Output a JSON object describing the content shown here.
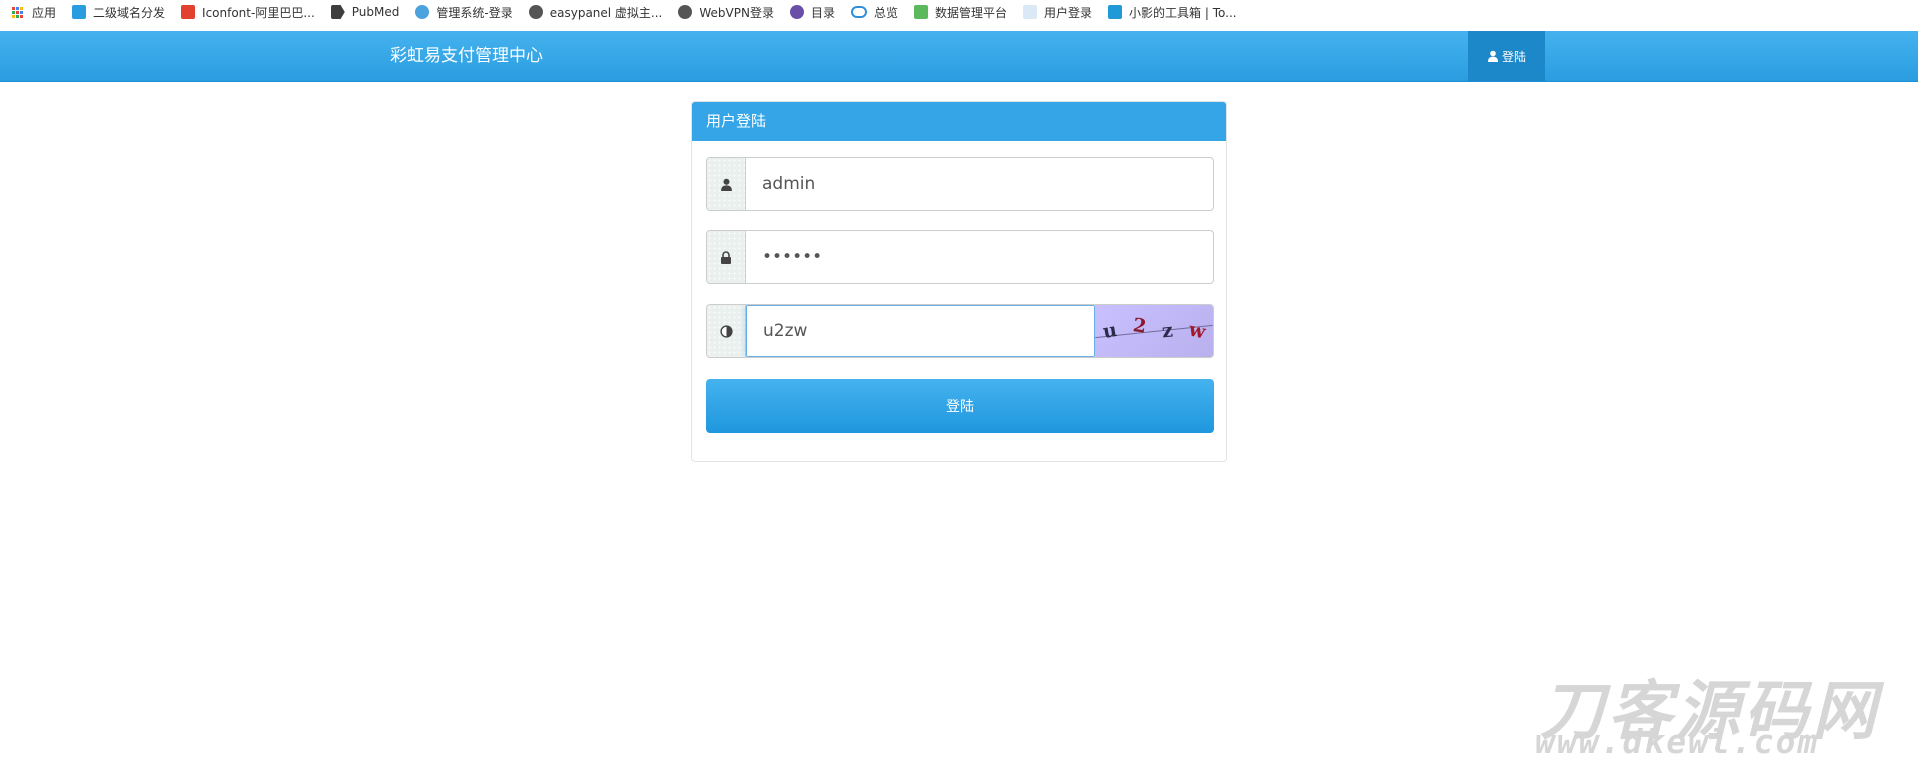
{
  "bookmarks": [
    {
      "label": "应用",
      "icon": "apps-grid-icon"
    },
    {
      "label": "二级域名分发",
      "icon": "shield-icon"
    },
    {
      "label": "Iconfont-阿里巴巴...",
      "icon": "iconfont-icon"
    },
    {
      "label": "PubMed",
      "icon": "pubmed-icon"
    },
    {
      "label": "管理系统-登录",
      "icon": "drop-icon"
    },
    {
      "label": "easypanel 虚拟主...",
      "icon": "globe-icon"
    },
    {
      "label": "WebVPN登录",
      "icon": "globe-icon"
    },
    {
      "label": "目录",
      "icon": "bug-icon"
    },
    {
      "label": "总览",
      "icon": "cloud-icon"
    },
    {
      "label": "数据管理平台",
      "icon": "leaf-icon"
    },
    {
      "label": "用户登录",
      "icon": "page-icon"
    },
    {
      "label": "小影的工具箱 | To...",
      "icon": "tool-icon"
    }
  ],
  "navbar": {
    "brand": "彩虹易支付管理中心",
    "login_label": "登陆"
  },
  "login": {
    "title": "用户登陆",
    "username": "admin",
    "password": "123456",
    "captcha_value": "u2zw",
    "captcha_chars": [
      "u",
      "2",
      "z",
      "w"
    ],
    "submit_label": "登陆"
  },
  "watermark": {
    "title": "刀客源码网",
    "url": "www.dkewl.com"
  },
  "colors": {
    "primary": "#35a5e8",
    "navbar_active": "#1d88c9",
    "captcha_bg": "#c9c0ff"
  }
}
